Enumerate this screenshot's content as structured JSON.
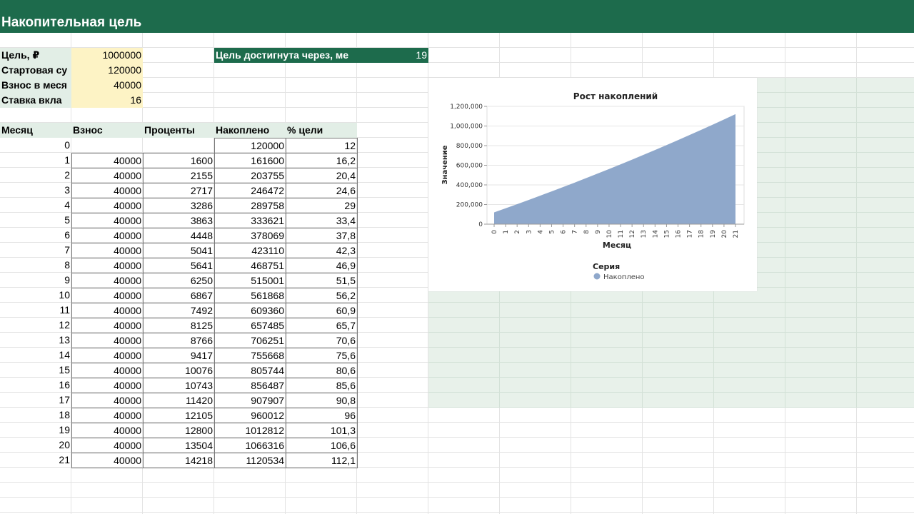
{
  "sheet": {
    "title": "Накопительная цель"
  },
  "params": [
    {
      "label": "Цель, ₽",
      "value": "1000000"
    },
    {
      "label": "Стартовая су",
      "value": "120000"
    },
    {
      "label": "Взнос в меся",
      "value": "40000"
    },
    {
      "label": "Ставка вкла",
      "value": "16"
    }
  ],
  "result": {
    "label": "Цель достигнута через, ме",
    "value": "19"
  },
  "table": {
    "headers": [
      "Месяц",
      "Взнос",
      "Проценты",
      "Накоплено",
      "% цели"
    ],
    "rows": [
      [
        "0",
        "",
        "",
        "120000",
        "12"
      ],
      [
        "1",
        "40000",
        "1600",
        "161600",
        "16,2"
      ],
      [
        "2",
        "40000",
        "2155",
        "203755",
        "20,4"
      ],
      [
        "3",
        "40000",
        "2717",
        "246472",
        "24,6"
      ],
      [
        "4",
        "40000",
        "3286",
        "289758",
        "29"
      ],
      [
        "5",
        "40000",
        "3863",
        "333621",
        "33,4"
      ],
      [
        "6",
        "40000",
        "4448",
        "378069",
        "37,8"
      ],
      [
        "7",
        "40000",
        "5041",
        "423110",
        "42,3"
      ],
      [
        "8",
        "40000",
        "5641",
        "468751",
        "46,9"
      ],
      [
        "9",
        "40000",
        "6250",
        "515001",
        "51,5"
      ],
      [
        "10",
        "40000",
        "6867",
        "561868",
        "56,2"
      ],
      [
        "11",
        "40000",
        "7492",
        "609360",
        "60,9"
      ],
      [
        "12",
        "40000",
        "8125",
        "657485",
        "65,7"
      ],
      [
        "13",
        "40000",
        "8766",
        "706251",
        "70,6"
      ],
      [
        "14",
        "40000",
        "9417",
        "755668",
        "75,6"
      ],
      [
        "15",
        "40000",
        "10076",
        "805744",
        "80,6"
      ],
      [
        "16",
        "40000",
        "10743",
        "856487",
        "85,6"
      ],
      [
        "17",
        "40000",
        "11420",
        "907907",
        "90,8"
      ],
      [
        "18",
        "40000",
        "12105",
        "960012",
        "96"
      ],
      [
        "19",
        "40000",
        "12800",
        "1012812",
        "101,3"
      ],
      [
        "20",
        "40000",
        "13504",
        "1066316",
        "106,6"
      ],
      [
        "21",
        "40000",
        "14218",
        "1120534",
        "112,1"
      ]
    ]
  },
  "chart_data": {
    "type": "area",
    "title": "Рост накоплений",
    "xlabel": "Месяц",
    "ylabel": "Значение",
    "x": [
      0,
      1,
      2,
      3,
      4,
      5,
      6,
      7,
      8,
      9,
      10,
      11,
      12,
      13,
      14,
      15,
      16,
      17,
      18,
      19,
      20,
      21
    ],
    "series": [
      {
        "name": "Накоплено",
        "color": "#8fa8cb",
        "values": [
          120000,
          161600,
          203755,
          246472,
          289758,
          333621,
          378069,
          423110,
          468751,
          515001,
          561868,
          609360,
          657485,
          706251,
          755668,
          805744,
          856487,
          907907,
          960012,
          1012812,
          1066316,
          1120534
        ]
      }
    ],
    "ylim": [
      0,
      1200000
    ],
    "yticks": [
      "0",
      "200,000",
      "400,000",
      "600,000",
      "800,000",
      "1,000,000",
      "1,200,000"
    ],
    "legend": {
      "title": "Серия",
      "position": "bottom"
    },
    "grid": true
  }
}
